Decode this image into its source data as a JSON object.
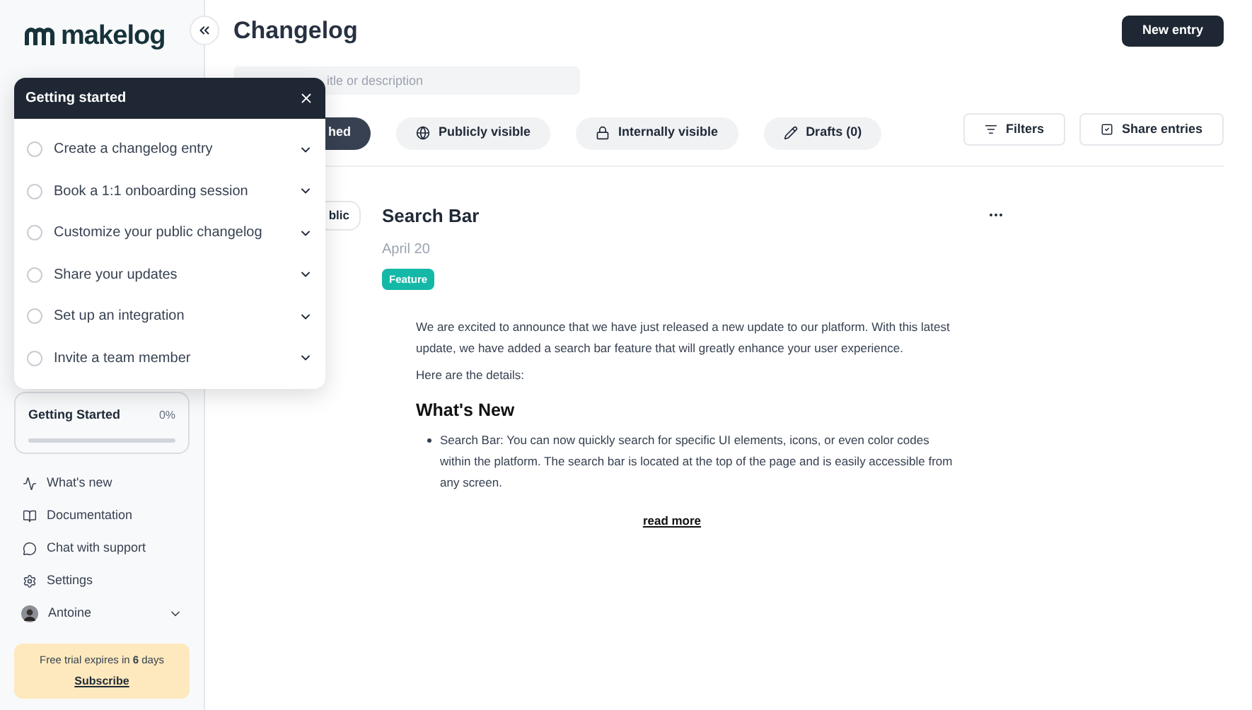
{
  "sidebar": {
    "logo": "makelog",
    "progress": {
      "title": "Getting Started",
      "reading": "0%",
      "level": 0
    },
    "nav": [
      {
        "label": "What's new",
        "kind": "activity"
      },
      {
        "label": "Documentation",
        "kind": "book"
      },
      {
        "label": "Chat with support",
        "kind": "chat"
      },
      {
        "label": "Settings",
        "kind": "settings"
      }
    ],
    "user": {
      "name": "Antoine"
    },
    "trial": {
      "text": "Free trial expires in **6** days",
      "link": "Subscribe"
    }
  },
  "header": {
    "title": "Changelog",
    "button": "New entry"
  },
  "search": {
    "placeholder": "itle or description"
  },
  "tabs": [
    {
      "label": "hed",
      "kind": "published",
      "selected": true
    },
    {
      "label": "Publicly visible",
      "kind": "public",
      "selected": false
    },
    {
      "label": "Internally visible",
      "kind": "internal",
      "selected": false
    },
    {
      "label": "Drafts (0)",
      "kind": "drafts",
      "selected": false
    }
  ],
  "actions": [
    {
      "label": "Filters",
      "kind": "filter"
    },
    {
      "label": "Share entries",
      "kind": "share"
    }
  ],
  "entry": {
    "visibility": "blic",
    "title": "Search Bar",
    "date": "April 20",
    "tag": "Feature",
    "paragraphs": [
      "We are excited to announce that we have just released a new update to our platform. With this latest update, we have added a search bar feature that will greatly enhance your user experience.",
      "Here are the details:"
    ],
    "heading": "What's New",
    "bullets": [
      "Search Bar: You can now quickly search for specific UI elements, icons, or even color codes within the platform. The search bar is located at the top of the page and is easily accessible from any screen."
    ],
    "read_more": "read more"
  },
  "popover": {
    "title": "Getting started",
    "items": [
      {
        "label": "Create a changelog entry",
        "checked": false
      },
      {
        "label": "Book a 1:1 onboarding session",
        "checked": false
      },
      {
        "label": "Customize your public changelog",
        "checked": false
      },
      {
        "label": "Share your updates",
        "checked": false
      },
      {
        "label": "Set up an integration",
        "checked": false
      },
      {
        "label": "Invite a team member",
        "checked": false
      }
    ]
  }
}
